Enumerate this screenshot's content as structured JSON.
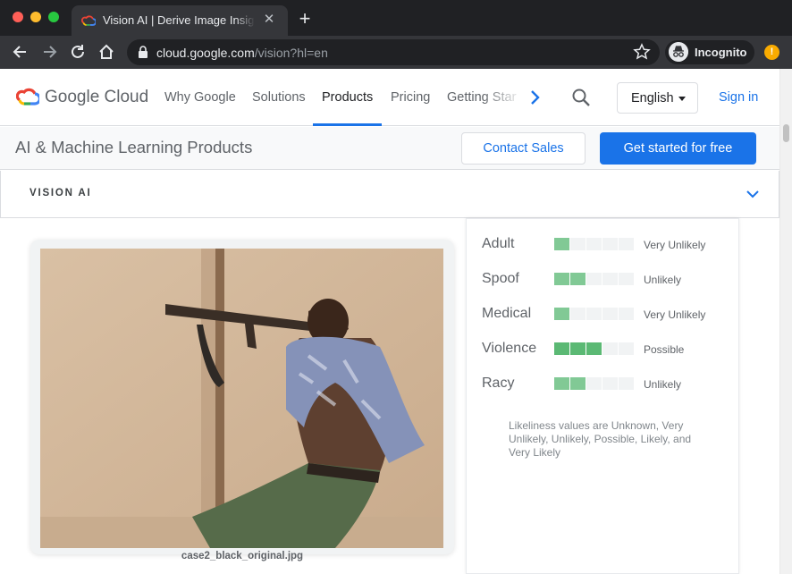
{
  "browser": {
    "tab_title": "Vision AI | Derive Image Insights",
    "close_glyph": "✕",
    "new_tab_glyph": "+",
    "url_host": "cloud.google.com",
    "url_path": "/vision?hl=en",
    "incognito_label": "Incognito",
    "extension_badge": "!"
  },
  "header": {
    "logo_text": "Google Cloud",
    "nav": [
      "Why Google",
      "Solutions",
      "Products",
      "Pricing",
      "Getting Started"
    ],
    "active_nav": "Products",
    "language": "English",
    "sign_in": "Sign in"
  },
  "subheader": {
    "title": "AI & Machine Learning Products",
    "contact_sales": "Contact Sales",
    "get_started": "Get started for free"
  },
  "section": {
    "title": "VISION AI"
  },
  "image": {
    "filename": "case2_black_original.jpg"
  },
  "safe_search": {
    "rows": [
      {
        "label": "Adult",
        "value": "Very Unlikely",
        "level": 1
      },
      {
        "label": "Spoof",
        "value": "Unlikely",
        "level": 2
      },
      {
        "label": "Medical",
        "value": "Very Unlikely",
        "level": 1
      },
      {
        "label": "Violence",
        "value": "Possible",
        "level": 3
      },
      {
        "label": "Racy",
        "value": "Unlikely",
        "level": 2
      }
    ],
    "max_level": 5,
    "note": "Likeliness values are Unknown, Very Unlikely, Unlikely, Possible, Likely, and Very Likely"
  },
  "colors": {
    "accent": "#1a73e8",
    "meter_on": "#81c995",
    "meter_strong": "#5bb974",
    "meter_off": "#f1f3f4"
  },
  "icons": {
    "back": "back-arrow-icon",
    "forward": "forward-arrow-icon",
    "reload": "reload-icon",
    "home": "home-icon",
    "lock": "lock-icon",
    "star": "star-icon",
    "incognito": "incognito-icon",
    "search": "search-icon",
    "chevron": "chevron-down-icon"
  }
}
